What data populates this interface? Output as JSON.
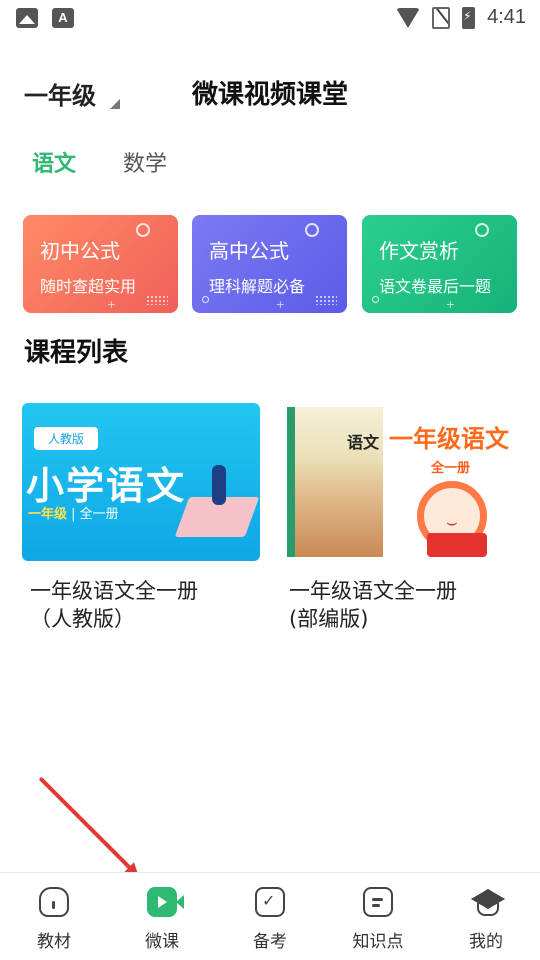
{
  "status_bar": {
    "time": "4:41",
    "left_icons": [
      "image-icon",
      "text-a-icon"
    ],
    "right_icons": [
      "wifi-icon",
      "no-sim-icon",
      "battery-charging-icon"
    ]
  },
  "header": {
    "grade": "一年级",
    "title": "微课视频课堂"
  },
  "tabs": [
    {
      "label": "语文",
      "active": true
    },
    {
      "label": "数学",
      "active": false
    }
  ],
  "feature_cards": [
    {
      "title": "初中公式",
      "subtitle": "随时查超实用",
      "color": "#f0605a"
    },
    {
      "title": "高中公式",
      "subtitle": "理科解题必备",
      "color": "#5b5be8"
    },
    {
      "title": "作文赏析",
      "subtitle": "语文卷最后一题",
      "color": "#16b27a"
    }
  ],
  "section_title": "课程列表",
  "courses": [
    {
      "title": "一年级语文全一册\n（人教版）",
      "cover": {
        "tag": "人教版",
        "heading": "小学语文",
        "grade": "一年级",
        "volume": "全一册"
      }
    },
    {
      "title": "一年级语文全一册\n(部编版)",
      "cover": {
        "book_title": "语文",
        "heading": "一年级语文",
        "volume": "全一册"
      }
    }
  ],
  "bottom_nav": [
    {
      "label": "教材",
      "icon": "textbook-icon",
      "active": false
    },
    {
      "label": "微课",
      "icon": "video-icon",
      "active": true
    },
    {
      "label": "备考",
      "icon": "exam-check-icon",
      "active": false
    },
    {
      "label": "知识点",
      "icon": "knowledge-icon",
      "active": false
    },
    {
      "label": "我的",
      "icon": "profile-cap-icon",
      "active": false
    }
  ],
  "accent_color": "#2eb872",
  "annotation_color": "#e13a35"
}
